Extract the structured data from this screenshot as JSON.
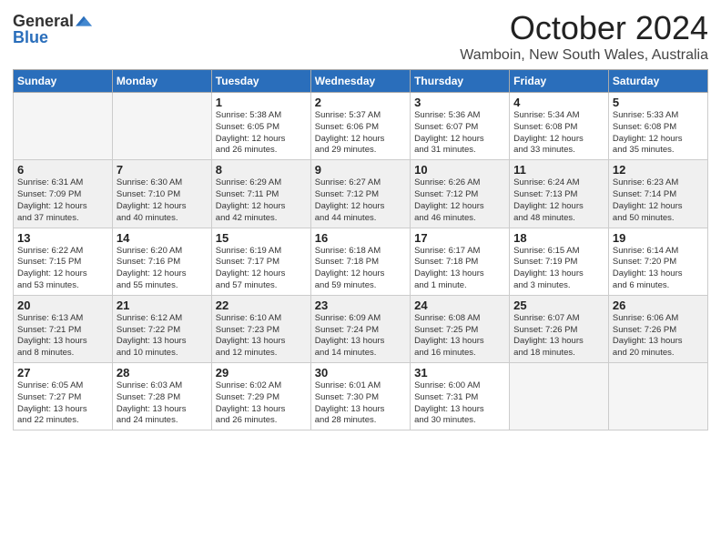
{
  "logo": {
    "general": "General",
    "blue": "Blue"
  },
  "header": {
    "title": "October 2024",
    "location": "Wamboin, New South Wales, Australia"
  },
  "weekdays": [
    "Sunday",
    "Monday",
    "Tuesday",
    "Wednesday",
    "Thursday",
    "Friday",
    "Saturday"
  ],
  "weeks": [
    [
      {
        "day": "",
        "info": ""
      },
      {
        "day": "",
        "info": ""
      },
      {
        "day": "1",
        "info": "Sunrise: 5:38 AM\nSunset: 6:05 PM\nDaylight: 12 hours\nand 26 minutes."
      },
      {
        "day": "2",
        "info": "Sunrise: 5:37 AM\nSunset: 6:06 PM\nDaylight: 12 hours\nand 29 minutes."
      },
      {
        "day": "3",
        "info": "Sunrise: 5:36 AM\nSunset: 6:07 PM\nDaylight: 12 hours\nand 31 minutes."
      },
      {
        "day": "4",
        "info": "Sunrise: 5:34 AM\nSunset: 6:08 PM\nDaylight: 12 hours\nand 33 minutes."
      },
      {
        "day": "5",
        "info": "Sunrise: 5:33 AM\nSunset: 6:08 PM\nDaylight: 12 hours\nand 35 minutes."
      }
    ],
    [
      {
        "day": "6",
        "info": "Sunrise: 6:31 AM\nSunset: 7:09 PM\nDaylight: 12 hours\nand 37 minutes."
      },
      {
        "day": "7",
        "info": "Sunrise: 6:30 AM\nSunset: 7:10 PM\nDaylight: 12 hours\nand 40 minutes."
      },
      {
        "day": "8",
        "info": "Sunrise: 6:29 AM\nSunset: 7:11 PM\nDaylight: 12 hours\nand 42 minutes."
      },
      {
        "day": "9",
        "info": "Sunrise: 6:27 AM\nSunset: 7:12 PM\nDaylight: 12 hours\nand 44 minutes."
      },
      {
        "day": "10",
        "info": "Sunrise: 6:26 AM\nSunset: 7:12 PM\nDaylight: 12 hours\nand 46 minutes."
      },
      {
        "day": "11",
        "info": "Sunrise: 6:24 AM\nSunset: 7:13 PM\nDaylight: 12 hours\nand 48 minutes."
      },
      {
        "day": "12",
        "info": "Sunrise: 6:23 AM\nSunset: 7:14 PM\nDaylight: 12 hours\nand 50 minutes."
      }
    ],
    [
      {
        "day": "13",
        "info": "Sunrise: 6:22 AM\nSunset: 7:15 PM\nDaylight: 12 hours\nand 53 minutes."
      },
      {
        "day": "14",
        "info": "Sunrise: 6:20 AM\nSunset: 7:16 PM\nDaylight: 12 hours\nand 55 minutes."
      },
      {
        "day": "15",
        "info": "Sunrise: 6:19 AM\nSunset: 7:17 PM\nDaylight: 12 hours\nand 57 minutes."
      },
      {
        "day": "16",
        "info": "Sunrise: 6:18 AM\nSunset: 7:18 PM\nDaylight: 12 hours\nand 59 minutes."
      },
      {
        "day": "17",
        "info": "Sunrise: 6:17 AM\nSunset: 7:18 PM\nDaylight: 13 hours\nand 1 minute."
      },
      {
        "day": "18",
        "info": "Sunrise: 6:15 AM\nSunset: 7:19 PM\nDaylight: 13 hours\nand 3 minutes."
      },
      {
        "day": "19",
        "info": "Sunrise: 6:14 AM\nSunset: 7:20 PM\nDaylight: 13 hours\nand 6 minutes."
      }
    ],
    [
      {
        "day": "20",
        "info": "Sunrise: 6:13 AM\nSunset: 7:21 PM\nDaylight: 13 hours\nand 8 minutes."
      },
      {
        "day": "21",
        "info": "Sunrise: 6:12 AM\nSunset: 7:22 PM\nDaylight: 13 hours\nand 10 minutes."
      },
      {
        "day": "22",
        "info": "Sunrise: 6:10 AM\nSunset: 7:23 PM\nDaylight: 13 hours\nand 12 minutes."
      },
      {
        "day": "23",
        "info": "Sunrise: 6:09 AM\nSunset: 7:24 PM\nDaylight: 13 hours\nand 14 minutes."
      },
      {
        "day": "24",
        "info": "Sunrise: 6:08 AM\nSunset: 7:25 PM\nDaylight: 13 hours\nand 16 minutes."
      },
      {
        "day": "25",
        "info": "Sunrise: 6:07 AM\nSunset: 7:26 PM\nDaylight: 13 hours\nand 18 minutes."
      },
      {
        "day": "26",
        "info": "Sunrise: 6:06 AM\nSunset: 7:26 PM\nDaylight: 13 hours\nand 20 minutes."
      }
    ],
    [
      {
        "day": "27",
        "info": "Sunrise: 6:05 AM\nSunset: 7:27 PM\nDaylight: 13 hours\nand 22 minutes."
      },
      {
        "day": "28",
        "info": "Sunrise: 6:03 AM\nSunset: 7:28 PM\nDaylight: 13 hours\nand 24 minutes."
      },
      {
        "day": "29",
        "info": "Sunrise: 6:02 AM\nSunset: 7:29 PM\nDaylight: 13 hours\nand 26 minutes."
      },
      {
        "day": "30",
        "info": "Sunrise: 6:01 AM\nSunset: 7:30 PM\nDaylight: 13 hours\nand 28 minutes."
      },
      {
        "day": "31",
        "info": "Sunrise: 6:00 AM\nSunset: 7:31 PM\nDaylight: 13 hours\nand 30 minutes."
      },
      {
        "day": "",
        "info": ""
      },
      {
        "day": "",
        "info": ""
      }
    ]
  ]
}
